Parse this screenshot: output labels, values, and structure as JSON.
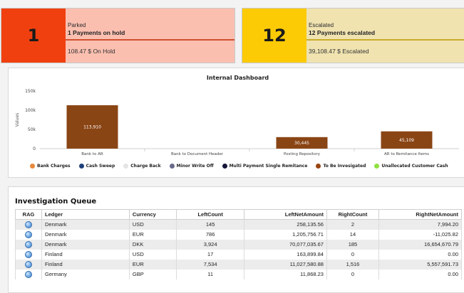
{
  "kpis": {
    "parked": {
      "count": "1",
      "status": "Parked",
      "headline": "1 Payments on hold",
      "amount": "108.47 $  On Hold",
      "color": "#f04010"
    },
    "escalated": {
      "count": "12",
      "status": "Escalated",
      "headline": "12 Payments escalated",
      "amount": "39,108.47 $ Escalated",
      "color": "#fccb06"
    }
  },
  "dashboard": {
    "title": "Internal Dashboard",
    "legend": [
      {
        "label": "Bank Charges",
        "color": "#e8883a"
      },
      {
        "label": "Cash Sweep",
        "color": "#1f3f7a"
      },
      {
        "label": "Charge Back",
        "color": "#e4e4e4"
      },
      {
        "label": "Minor Write Off",
        "color": "#6a6a8a"
      },
      {
        "label": "Multi Payment Single Remitance",
        "color": "#15153a"
      },
      {
        "label": "To Be Invesigated",
        "color": "#9a4512"
      },
      {
        "label": "Unallocated Customer Cash",
        "color": "#90e040"
      }
    ]
  },
  "chart_data": {
    "type": "bar",
    "title": "Internal Dashboard",
    "xlabel": "",
    "ylabel": "Values",
    "ylim": [
      0,
      150000
    ],
    "yticks": [
      "0",
      "50k",
      "100k",
      "150k"
    ],
    "ytick_values": [
      0,
      50000,
      100000,
      150000
    ],
    "grid": false,
    "legend_position": "bottom",
    "categories": [
      "Bank to AR",
      "Bank to Document Header",
      "Posting Repository",
      "AR to Remitance Items"
    ],
    "series": [
      {
        "name": "To Be Invesigated",
        "color": "#8a4515",
        "values": [
          113000,
          null,
          30000,
          45000
        ],
        "labels": [
          "113,910",
          "",
          "30,445",
          "45,109"
        ]
      }
    ]
  },
  "queue": {
    "title": "Investigation Queue",
    "columns": [
      "RAG",
      "Ledger",
      "Currency",
      "LeftCount",
      "LeftNetAmount",
      "RightCount",
      "RightNetAmount"
    ],
    "rows": [
      [
        "Denmark",
        "USD",
        "145",
        "258,135.56",
        "2",
        "7,994.20"
      ],
      [
        "Denmark",
        "EUR",
        "786",
        "1,205,756.71",
        "14",
        "-11,025.82"
      ],
      [
        "Denmark",
        "DKK",
        "3,924",
        "70,077,035.67",
        "185",
        "16,654,670.79"
      ],
      [
        "Finland",
        "USD",
        "17",
        "163,899.84",
        "0",
        "0.00"
      ],
      [
        "Finland",
        "EUR",
        "7,534",
        "11,027,580.88",
        "1,516",
        "5,557,591.73"
      ],
      [
        "Germany",
        "GBP",
        "11",
        "11,868.23",
        "0",
        "0.00"
      ]
    ],
    "rag_color": "#6aa6e4"
  }
}
